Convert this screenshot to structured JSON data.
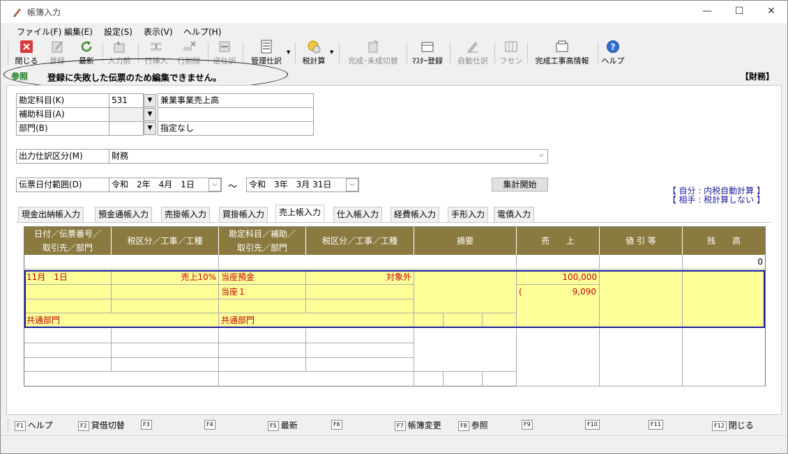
{
  "window": {
    "title": "帳簿入力",
    "minimize": "—",
    "maximize": "☐",
    "close": "✕"
  },
  "menu": [
    "ファイル(F)",
    "編集(E)",
    "設定(S)",
    "表示(V)",
    "ヘルプ(H)"
  ],
  "toolbar": {
    "close": "閉じる",
    "register": "登録",
    "refresh": "最新",
    "prev_input": "入力前",
    "insert_row": "行挿入",
    "delete_row": "行削除",
    "reverse": "逆仕訳",
    "manage": "管理仕訳",
    "tax_calc": "税計算",
    "complete_toggle": "完成･未成切替",
    "master_register": "ﾏｽﾀｰ登録",
    "auto_journal": "自動仕訳",
    "fusen": "フセン",
    "completion_info": "完成工事高情報",
    "help": "ヘルプ"
  },
  "mode": {
    "label": "参照",
    "message": "登録に失敗した伝票のため編集できません。",
    "right": "【財務】"
  },
  "form": {
    "account_label": "勘定科目(K)",
    "account_code": "531",
    "account_name": "兼業事業売上高",
    "sub_label": "補助科目(A)",
    "sub_code": "",
    "sub_name": "",
    "dept_label": "部門(B)",
    "dept_code": "",
    "dept_name": "指定なし",
    "output_label": "出力仕訳区分(M)",
    "output_value": "財務",
    "date_label": "伝票日付範囲(D)",
    "date_from": "令和　2年　4月　1日",
    "tilde": "～",
    "date_to": "令和　3年　3月 31日",
    "aggregate_button": "集計開始"
  },
  "legend": {
    "line1": "【 自分 : 内税自動計算 】",
    "line2": "【 相手 : 税計算しない 】"
  },
  "tabs": [
    "現金出納帳入力",
    "預金通帳入力",
    "売掛帳入力",
    "買掛帳入力",
    "売上帳入力",
    "仕入帳入力",
    "経費帳入力",
    "手形入力",
    "電債入力"
  ],
  "active_tab": "売上帳入力",
  "grid": {
    "headers": {
      "date": "日付／伝票番号／\n取引先／部門",
      "tax1": "税区分／工事／工種",
      "account": "勘定科目／補助／\n取引先／部門",
      "tax2": "税区分／工事／工種",
      "memo": "摘要",
      "sales": "売　　上",
      "discount": "値 引 等",
      "balance": "残　　高"
    },
    "opening_balance": "0",
    "row": {
      "date": "11月　1日",
      "tax1": "売上10%",
      "account": "当座預金",
      "tax2": "対象外",
      "sub": "当座１",
      "dept1": "共通部門",
      "dept2": "共通部門",
      "sales": "100,000",
      "tax_paren": "(",
      "tax_amount": "9,090"
    }
  },
  "fkeys": [
    {
      "key": "F1",
      "label": "ヘルプ"
    },
    {
      "key": "F2",
      "label": "貸借切替"
    },
    {
      "key": "F3",
      "label": ""
    },
    {
      "key": "F4",
      "label": ""
    },
    {
      "key": "F5",
      "label": "最新"
    },
    {
      "key": "F6",
      "label": ""
    },
    {
      "key": "F7",
      "label": "帳簿変更"
    },
    {
      "key": "F8",
      "label": "参照"
    },
    {
      "key": "F9",
      "label": ""
    },
    {
      "key": "F10",
      "label": ""
    },
    {
      "key": "F11",
      "label": ""
    },
    {
      "key": "F12",
      "label": "閉じる"
    }
  ]
}
